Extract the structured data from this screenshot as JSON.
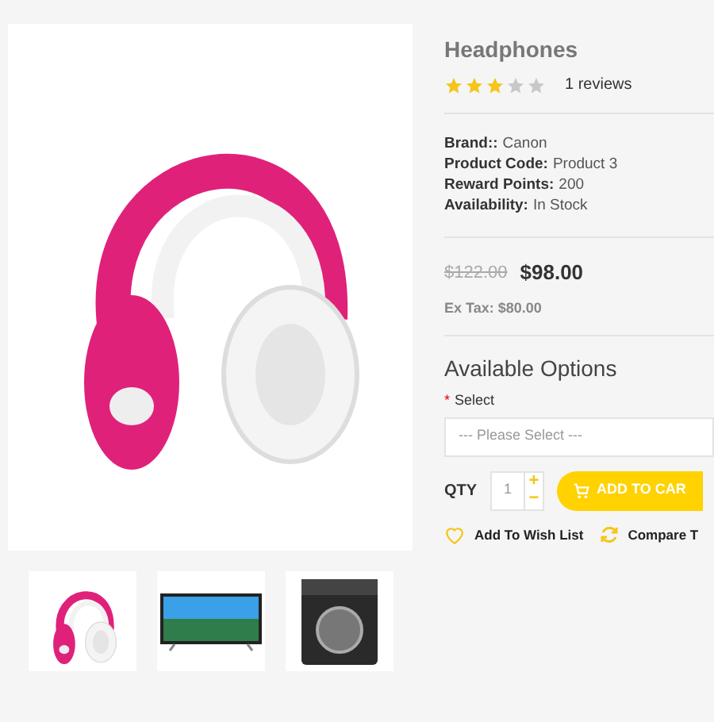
{
  "product": {
    "title": "Headphones",
    "stars": 3,
    "reviews": "1 reviews",
    "specs": [
      {
        "label": "Brand::",
        "value": "Canon"
      },
      {
        "label": "Product Code:",
        "value": "Product 3"
      },
      {
        "label": "Reward Points:",
        "value": "200"
      },
      {
        "label": "Availability:",
        "value": "In Stock"
      }
    ],
    "old_price": "$122.00",
    "price": "$98.00",
    "ex_tax": "Ex Tax: $80.00"
  },
  "options": {
    "heading": "Available Options",
    "required_mark": "*",
    "label": "Select",
    "placeholder": "--- Please Select ---"
  },
  "qty": {
    "label": "QTY",
    "value": "1",
    "plus": "+",
    "minus": "−"
  },
  "add_to_cart": "ADD TO CAR",
  "links": [
    {
      "kind": "wishlist",
      "label": "Add To Wish List"
    },
    {
      "kind": "compare",
      "label": "Compare T"
    }
  ],
  "thumbnails": [
    {
      "kind": "headphones"
    },
    {
      "kind": "tv"
    },
    {
      "kind": "washer"
    }
  ]
}
